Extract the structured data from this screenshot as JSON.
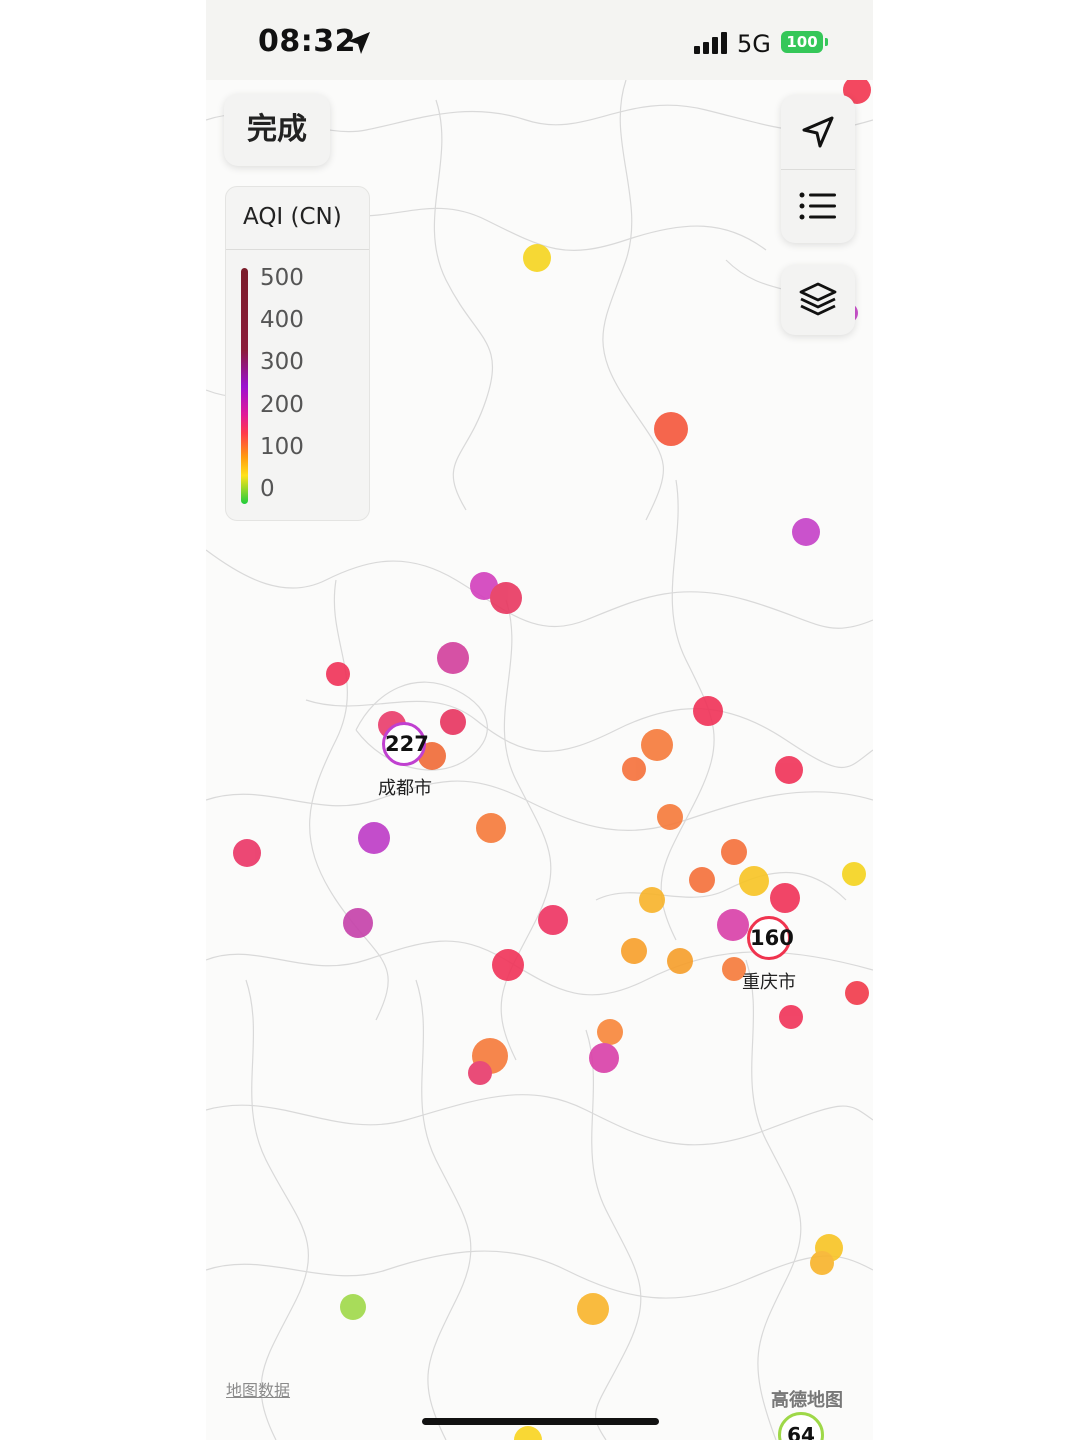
{
  "status_bar": {
    "time": "08:32",
    "network": "5G",
    "battery": "100",
    "colors": {
      "battery": "#35c759"
    }
  },
  "controls": {
    "done_label": "完成",
    "locate_icon": "navigation-arrow-icon",
    "list_icon": "list-icon",
    "layers_icon": "layers-icon"
  },
  "legend": {
    "title": "AQI (CN)",
    "ticks": [
      "500",
      "400",
      "300",
      "200",
      "100",
      "0"
    ],
    "colors": [
      "#7a1c2a",
      "#9b10d0",
      "#e0189a",
      "#ff3a4a",
      "#ff9a10",
      "#ffe21a",
      "#1fcc3c"
    ]
  },
  "markers": [
    {
      "value": "227",
      "city": "成都市",
      "color": "#c040d0"
    },
    {
      "value": "160",
      "city": "重庆市",
      "color": "#f0344f"
    },
    {
      "value": "64",
      "color": "#9ed848"
    }
  ],
  "map": {
    "attribution": "地图数据",
    "provider": "高德地图"
  }
}
